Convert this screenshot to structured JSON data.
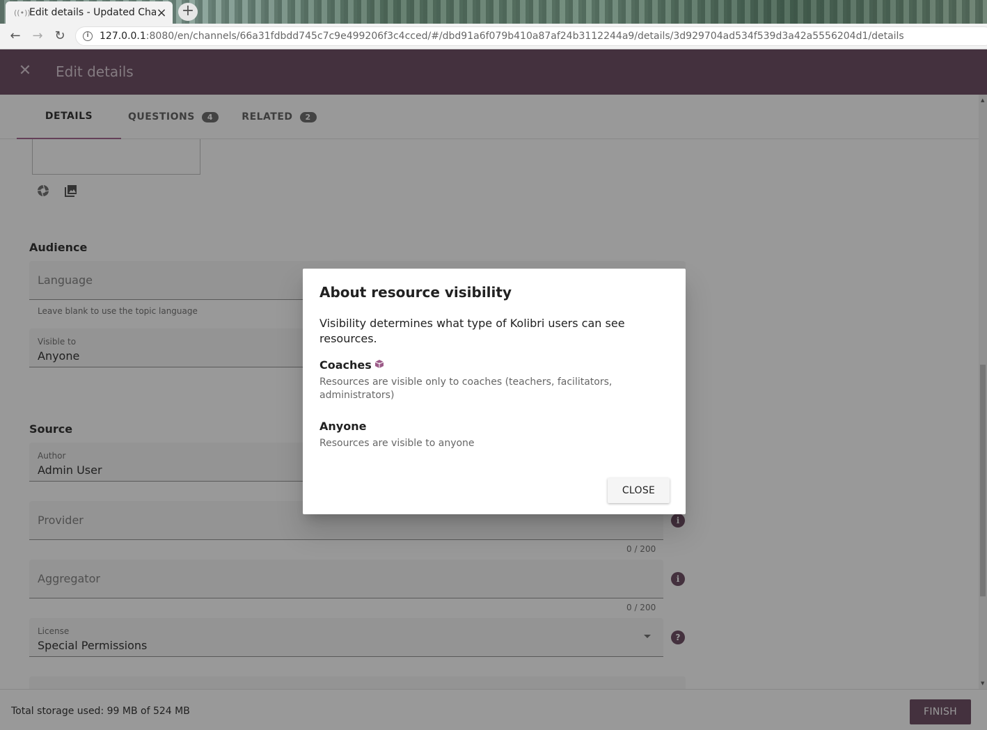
{
  "browser": {
    "tab_title": "Edit details - Updated Cha",
    "url_host": "127.0.0.1",
    "url_rest": ":8080/en/channels/66a31fdbdd745c7c9e499206f3c4cced/#/dbd91a6f079b410a87af24b3112244a9/details/3d929704ad534f539d3a42a5556204d1/details"
  },
  "header": {
    "title": "Edit details"
  },
  "tabs": [
    {
      "label": "DETAILS",
      "count": ""
    },
    {
      "label": "QUESTIONS",
      "count": "4"
    },
    {
      "label": "RELATED",
      "count": "2"
    }
  ],
  "audience": {
    "heading": "Audience",
    "language_placeholder": "Language",
    "language_hint": "Leave blank to use the topic language",
    "visible_label": "Visible to",
    "visible_value": "Anyone"
  },
  "source": {
    "heading": "Source",
    "author_label": "Author",
    "author_value": "Admin User",
    "provider_placeholder": "Provider",
    "provider_counter": "0 / 200",
    "aggregator_placeholder": "Aggregator",
    "aggregator_counter": "0 / 200",
    "license_label": "License",
    "license_value": "Special Permissions"
  },
  "footer": {
    "storage": "Total storage used: 99 MB of 524 MB",
    "finish_label": "FINISH"
  },
  "dialog": {
    "title": "About resource visibility",
    "intro": "Visibility determines what type of Kolibri users can see resources.",
    "coaches_heading": "Coaches",
    "coaches_desc": "Resources are visible only to coaches (teachers, facilitators, administrators)",
    "anyone_heading": "Anyone",
    "anyone_desc": "Resources are visible to anyone",
    "close_label": "CLOSE"
  },
  "colors": {
    "brand": "#623f58",
    "accent": "#9c5b88"
  }
}
